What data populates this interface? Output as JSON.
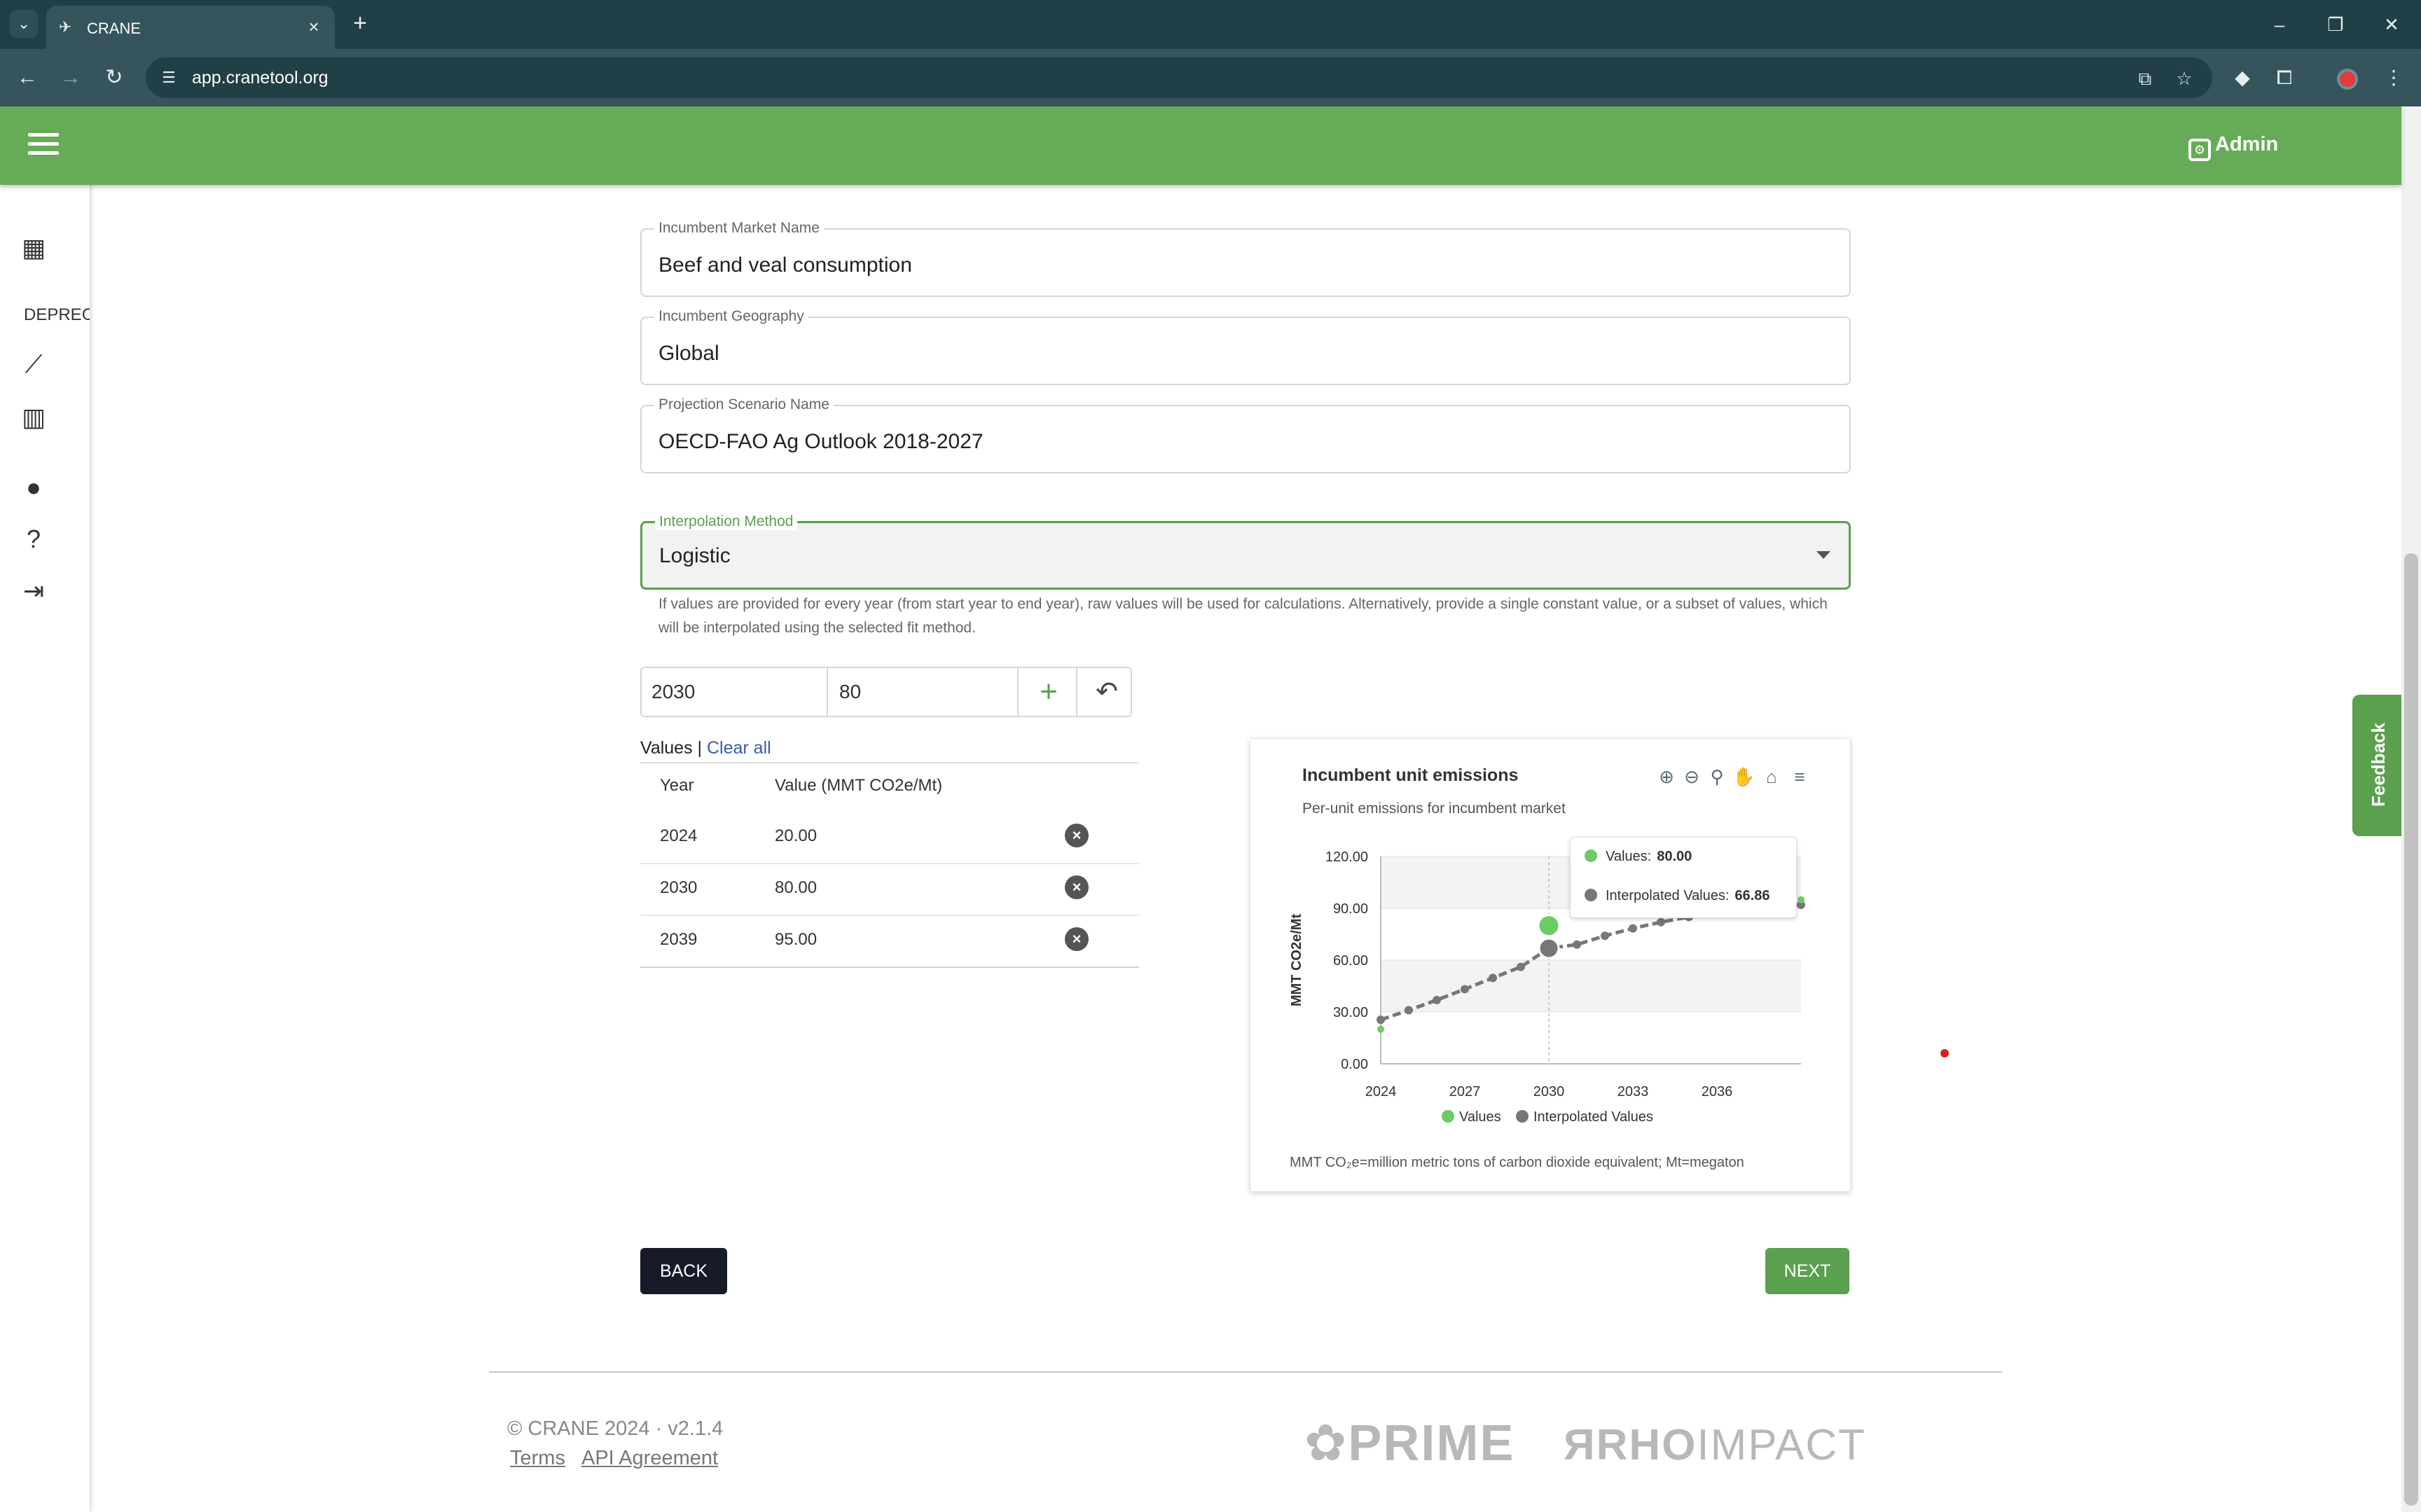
{
  "browser": {
    "tab_title": "CRANE",
    "url": "app.cranetool.org",
    "icons": {
      "tab_dropdown": "chevron-down-icon",
      "back": "arrow-left-icon",
      "forward": "arrow-right-icon",
      "reload": "reload-icon",
      "site_info": "tune-icon",
      "install": "install-app-icon",
      "bookmark": "star-icon",
      "extensions": "puzzle-icon"
    }
  },
  "app": {
    "brand_color": "#66ac58",
    "admin_label": "Admin",
    "sidebar": {
      "deprecated_label": "DEPRECA",
      "icons": [
        "table-icon",
        "trend-line-icon",
        "bar-chart-icon",
        "person-icon",
        "help-circle-icon",
        "logout-icon"
      ]
    }
  },
  "form": {
    "market_name": {
      "label": "Incumbent Market Name",
      "value": "Beef and veal consumption"
    },
    "geography": {
      "label": "Incumbent Geography",
      "value": "Global"
    },
    "scenario": {
      "label": "Projection Scenario Name",
      "value": "OECD-FAO Ag Outlook 2018-2027"
    },
    "interpolation": {
      "label": "Interpolation Method",
      "value": "Logistic"
    },
    "helper_text": "If values are provided for every year (from start year to end year), raw values will be used for calculations. Alternatively, provide a single constant value, or a subset of values, which will be interpolated using the selected fit method.",
    "entry": {
      "year": "2030",
      "value": "80"
    }
  },
  "values_table": {
    "heading": "Values",
    "separator": "|",
    "clear_all": "Clear all",
    "columns": [
      "Year",
      "Value (MMT CO2e/Mt)"
    ],
    "rows": [
      {
        "year": "2024",
        "value": "20.00"
      },
      {
        "year": "2030",
        "value": "80.00"
      },
      {
        "year": "2039",
        "value": "95.00"
      }
    ]
  },
  "chart": {
    "title": "Incumbent unit emissions",
    "subtitle": "Per-unit emissions for incumbent market",
    "note": "MMT CO₂e=million metric tons of carbon dioxide equivalent; Mt=megaton",
    "tooltip": {
      "values_label": "Values:",
      "values_value": "80.00",
      "interp_label": "Interpolated Values:",
      "interp_value": "66.86"
    },
    "colors": {
      "values": "#6ccb63",
      "interpolated": "#777777"
    }
  },
  "chart_data": {
    "type": "line",
    "title": "Incumbent unit emissions",
    "subtitle": "Per-unit emissions for incumbent market",
    "ylabel": "MMT CO2e/Mt",
    "xlabel": "",
    "x_ticks": [
      "2024",
      "2027",
      "2030",
      "2033",
      "2036"
    ],
    "y_ticks": [
      "0.00",
      "30.00",
      "60.00",
      "90.00",
      "120.00"
    ],
    "xlim": [
      2024,
      2039
    ],
    "ylim": [
      0,
      120
    ],
    "legend": "bottom",
    "series": [
      {
        "name": "Values",
        "type": "scatter",
        "x": [
          2024,
          2030,
          2039
        ],
        "y": [
          20,
          80,
          95
        ]
      },
      {
        "name": "Interpolated Values",
        "type": "line",
        "x": [
          2024,
          2025,
          2026,
          2027,
          2028,
          2029,
          2030,
          2031,
          2032,
          2033,
          2034,
          2035,
          2036,
          2037,
          2038,
          2039
        ],
        "y": [
          25.5,
          31.0,
          36.9,
          43.2,
          49.7,
          56.1,
          66.86,
          69.0,
          74.1,
          78.4,
          82.0,
          85.0,
          87.4,
          89.3,
          90.8,
          92.0
        ]
      }
    ]
  },
  "buttons": {
    "back": "BACK",
    "next": "NEXT"
  },
  "feedback_label": "Feedback",
  "footer": {
    "copyright": "© CRANE 2024 ·  v2.1.4",
    "terms": "Terms",
    "api": "API Agreement",
    "logo_prime": "PRIME",
    "logo_rho": "RHO",
    "logo_impact": "IMPACT"
  }
}
